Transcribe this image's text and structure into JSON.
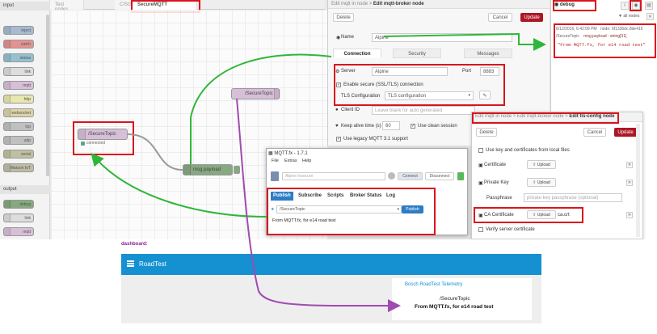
{
  "palette": {
    "input_header": "input",
    "output_header": "output",
    "input_nodes": [
      {
        "label": "inject",
        "color": "#a6bbcf"
      },
      {
        "label": "catch",
        "color": "#e49191"
      },
      {
        "label": "status",
        "color": "#94c1d0"
      },
      {
        "label": "link",
        "color": "#dddddd"
      },
      {
        "label": "mqtt",
        "color": "#d8bfd8"
      },
      {
        "label": "http",
        "color": "#e7e7ae"
      },
      {
        "label": "websocket",
        "color": "#dbd4a8"
      },
      {
        "label": "tcp",
        "color": "#c0c0c0"
      },
      {
        "label": "udp",
        "color": "#c0c0c0"
      },
      {
        "label": "serial",
        "color": "#c0c0a0"
      },
      {
        "label": "Watson IoT",
        "color": "#bdbda6"
      }
    ],
    "output_nodes": [
      {
        "label": "debug",
        "color": "#87a980"
      },
      {
        "label": "link",
        "color": "#dddddd"
      },
      {
        "label": "mqtt",
        "color": "#d8bfd8"
      }
    ]
  },
  "workspace_tabs": [
    "Test nodes",
    "CISGateway",
    "SecureMQTT"
  ],
  "flow": {
    "mqtt_in_label": "/SecureTopic",
    "mqtt_in_status": "connected",
    "debug_node_label": "msg.payload",
    "mqtt_out_label": "/SecureTopic",
    "node_colors": {
      "mqtt": "#d8bfd8",
      "debug": "#87a980",
      "status_ok": "#5a8"
    }
  },
  "broker_panel": {
    "breadcrumb": "Edit mqtt in node >",
    "title": "Edit mqtt-broker node",
    "delete_label": "Delete",
    "cancel_label": "Cancel",
    "update_label": "Update",
    "name_label": "Name",
    "name_value": "Alpine",
    "tabs": [
      "Connection",
      "Security",
      "Messages"
    ],
    "server_label": "Server",
    "server_value": "Alpine",
    "port_label": "Port",
    "port_value": "8883",
    "tls_check_label": "Enable secure (SSL/TLS) connection",
    "tls_config_label": "TLS Configuration",
    "tls_config_value": "TLS configuration",
    "client_id_label": "Client ID",
    "client_id_placeholder": "Leave blank for auto generated",
    "keepalive_label": "Keep alive time (s)",
    "keepalive_value": "60",
    "clean_session_label": "Use clean session",
    "legacy_label": "Use legacy MQTT 3.1 support"
  },
  "debug_panel": {
    "title": "debug",
    "filter_label": "all nodes",
    "timestamp": "6/12/2016, 6:42:09 PM",
    "node_id": "node: 6f1336dc.8de416",
    "topic": "/SecureTopic",
    "payload_type": "msg.payload : string[31]",
    "payload": "\"From MQTT.fx, for e14 road test\""
  },
  "tls_panel": {
    "breadcrumb": "Edit mqtt in node > Edit mqtt-broker node >",
    "title": "Edit tls-config node",
    "delete_label": "Delete",
    "cancel_label": "Cancel",
    "update_label": "Update",
    "use_key_label": "Use key and certificates from local files",
    "certificate_label": "Certificate",
    "private_key_label": "Private Key",
    "passphrase_label": "Passphrase",
    "passphrase_placeholder": "private key passphrase (optional)",
    "ca_label": "CA Certificate",
    "ca_value": "ca.crt",
    "upload_label": "Upload",
    "verify_label": "Verify server certificate"
  },
  "mqttfx": {
    "title": "MQTT.fx - 1.7.1",
    "menu": [
      "File",
      "Extras",
      "Help"
    ],
    "profile": "Alpine Insecure",
    "connect_label": "Connect",
    "disconnect_label": "Disconnect",
    "tabs": [
      "Publish",
      "Subscribe",
      "Scripts",
      "Broker Status",
      "Log"
    ],
    "topic": "/SecureTopic",
    "publish_label": "Publish",
    "message": "From MQTT.fx, for e14 road test",
    "accent": "#2d7dc6"
  },
  "dashboard": {
    "label": "dashboard:",
    "title": "RoadTest",
    "card_title": "Bosch RoadTest Telemetry",
    "topic": "/SecureTopic",
    "message": "From MQTT.fx, for e14 road test",
    "bar_color": "#1591d1"
  },
  "annotation_colors": {
    "red": "#d9141e",
    "green": "#2fb63a",
    "purple": "#a04bb0"
  }
}
